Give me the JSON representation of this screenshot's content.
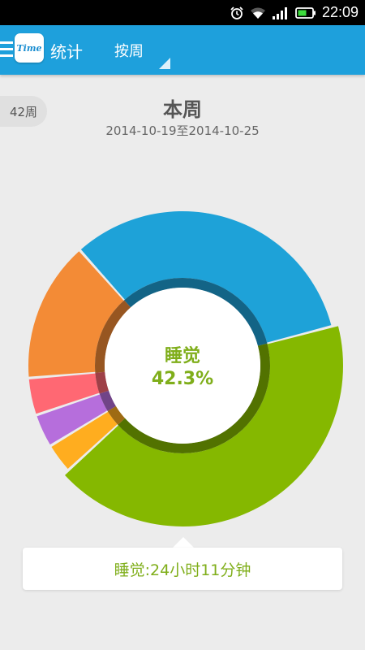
{
  "status_bar": {
    "time": "22:09"
  },
  "app_bar": {
    "title": "统计",
    "period": "按周",
    "logo_text": "Time",
    "color": "#1ea0dc"
  },
  "header": {
    "week_chip": "42周",
    "title": "本周",
    "date_range": "2014-10-19至2014-10-25"
  },
  "chart_data": {
    "type": "pie",
    "style": "donut",
    "slices": [
      {
        "label": "睡觉",
        "percent": 42.3,
        "color": "#85b800",
        "selected": true
      },
      {
        "color": "#ffad1f",
        "percent": 3.1
      },
      {
        "color": "#b66edc",
        "percent": 3.5
      },
      {
        "color": "#ff6873",
        "percent": 3.9
      },
      {
        "color": "#f38b36",
        "percent": 14.7
      },
      {
        "color": "#1ea2d8",
        "percent": 32.5
      }
    ],
    "center_label": "睡觉",
    "center_value": "42.3%"
  },
  "tooltip": {
    "text": "睡觉:24小时11分钟"
  }
}
